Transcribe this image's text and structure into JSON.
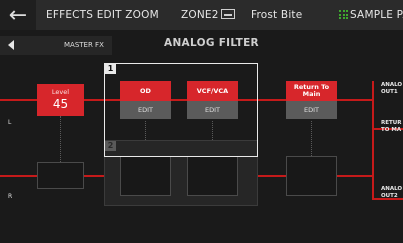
{
  "header": {
    "title": "EFFECTS EDIT ZOOM",
    "zone": "ZONE2",
    "patch_name": "Frost Bite",
    "sample_pad": "SAMPLE PA"
  },
  "nav": {
    "master_fx": "MASTER FX",
    "screen_title": "ANALOG FILTER"
  },
  "sides": {
    "left": "L",
    "right": "R"
  },
  "level": {
    "label": "Level",
    "value": "45"
  },
  "groups": [
    {
      "number": "1",
      "blocks": [
        {
          "name": "OD",
          "edit": "EDIT"
        },
        {
          "name": "VCF/VCA",
          "edit": "EDIT"
        }
      ]
    },
    {
      "number": "2"
    }
  ],
  "return_block": {
    "name": "Return To Main",
    "edit": "EDIT"
  },
  "outputs": {
    "out1": [
      "ANALO",
      "OUT1"
    ],
    "return": [
      "RETUR",
      "TO MA"
    ],
    "out2": [
      "ANALO",
      "OUT2"
    ]
  },
  "colors": {
    "accent": "#d7262b",
    "signal": "#c61a1a",
    "grid_icon": "#3ea82e"
  },
  "icons": {
    "back": "back-arrow-icon",
    "zone": "zone-keyboard-icon",
    "pad": "pad-grid-icon",
    "master": "left-triangle-icon"
  }
}
